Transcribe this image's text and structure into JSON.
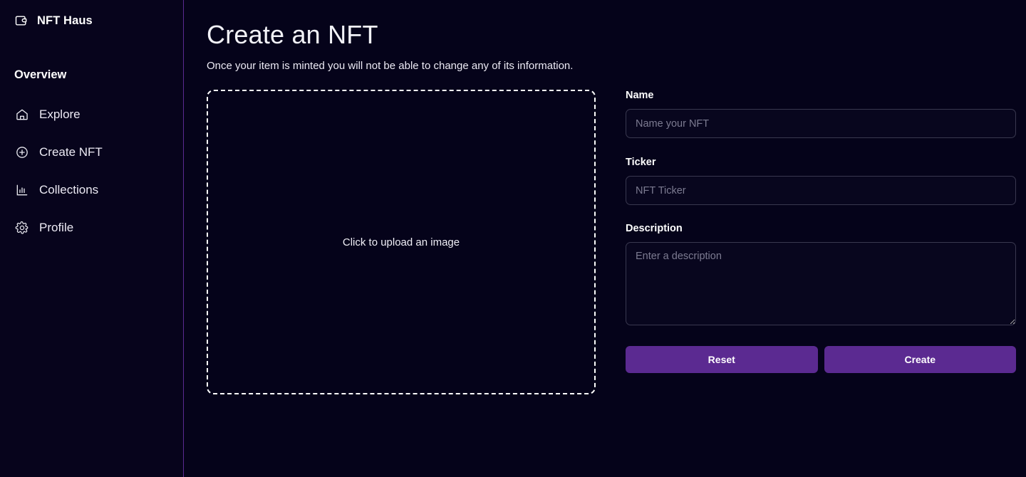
{
  "sidebar": {
    "brand": {
      "name": "NFT Haus",
      "icon": "wallet-icon"
    },
    "section_label": "Overview",
    "items": [
      {
        "label": "Explore",
        "icon": "home-icon"
      },
      {
        "label": "Create NFT",
        "icon": "plus-circle-icon"
      },
      {
        "label": "Collections",
        "icon": "bar-chart-icon"
      },
      {
        "label": "Profile",
        "icon": "gear-icon"
      }
    ]
  },
  "main": {
    "title": "Create an NFT",
    "subtitle": "Once your item is minted you will not be able to change any of its information.",
    "dropzone": {
      "text": "Click to upload an image"
    },
    "form": {
      "name": {
        "label": "Name",
        "value": "",
        "placeholder": "Name your NFT"
      },
      "ticker": {
        "label": "Ticker",
        "value": "",
        "placeholder": "NFT Ticker"
      },
      "description": {
        "label": "Description",
        "value": "",
        "placeholder": "Enter a description"
      },
      "reset_label": "Reset",
      "create_label": "Create"
    }
  },
  "colors": {
    "background": "#05031a",
    "sidebar_background": "#07041c",
    "accent_purple": "#5b2a91",
    "divider": "#5b2a91",
    "input_border": "#39384f",
    "placeholder": "#7c7b91"
  }
}
